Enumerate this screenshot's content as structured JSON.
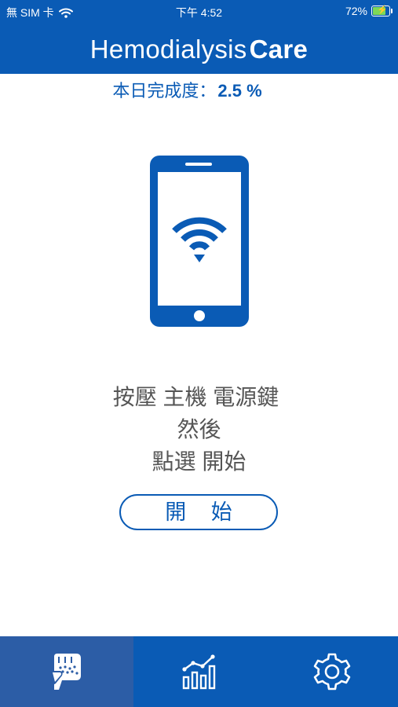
{
  "status_bar": {
    "carrier": "無 SIM 卡",
    "time": "下午 4:52",
    "battery": "72%"
  },
  "header": {
    "title_regular": "Hemodialysis",
    "title_bold": "Care"
  },
  "progress": {
    "label": "本日完成度：",
    "value": "2.5 %"
  },
  "instructions": {
    "line1": "按壓 主機 電源鍵",
    "line2": "然後",
    "line3": "點選 開始"
  },
  "start_button": {
    "label": "開 始"
  },
  "tabs": [
    {
      "icon": "fist-icon",
      "selected": true
    },
    {
      "icon": "bar-chart-icon",
      "selected": false
    },
    {
      "icon": "gear-icon",
      "selected": false
    }
  ],
  "colors": {
    "brand": "#0a5bb5",
    "tab_selected": "#2c5da6",
    "text": "#555555"
  }
}
